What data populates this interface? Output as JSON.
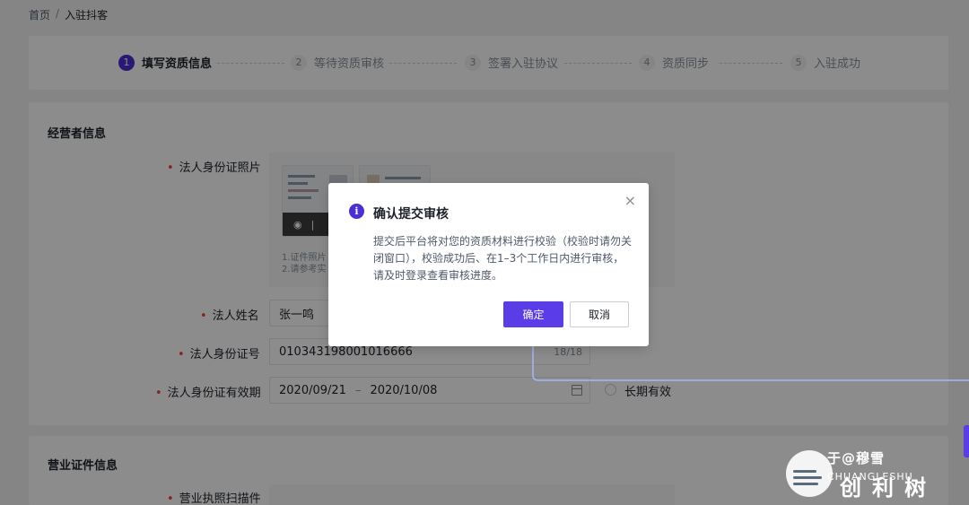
{
  "breadcrumb": {
    "home": "首页",
    "separator": "/",
    "current": "入驻抖客"
  },
  "steps": [
    {
      "num": "1",
      "label": "填写资质信息"
    },
    {
      "num": "2",
      "label": "等待资质审核"
    },
    {
      "num": "3",
      "label": "签署入驻协议"
    },
    {
      "num": "4",
      "label": "资质同步"
    },
    {
      "num": "5",
      "label": "入驻成功"
    }
  ],
  "operator_section": {
    "title": "经营者信息",
    "id_photo_label": "法人身份证照片",
    "upload_tip_1": "1.证件照片",
    "upload_tip_2": "2.请参考实",
    "name_label": "法人姓名",
    "name_value": "张一鸣",
    "id_label": "法人身份证号",
    "id_value": "010343198001016666",
    "id_count": "18/18",
    "validity_label": "法人身份证有效期",
    "date_start": "2020/09/21",
    "date_sep": "–",
    "date_end": "2020/10/08",
    "long_term_label": "长期有效"
  },
  "license_section": {
    "title": "营业证件信息",
    "scan_label": "营业执照扫描件"
  },
  "modal": {
    "title": "确认提交审核",
    "body": "提交后平台将对您的资质材料进行校验（校验时请勿关闭窗口），校验成功后、在1–3个工作日内进行审核，请及时登录查看审核进度。",
    "confirm_label": "确定",
    "cancel_label": "取消",
    "close_glyph": "×",
    "info_glyph": "i"
  },
  "watermark": {
    "line1": "于@穆雪",
    "brand": "CHUANGLESHU",
    "line2": "创利树"
  },
  "colors": {
    "primary": "#5b3de8",
    "required": "#f53f3f",
    "overlay": "rgba(0,0,0,0.45)"
  }
}
